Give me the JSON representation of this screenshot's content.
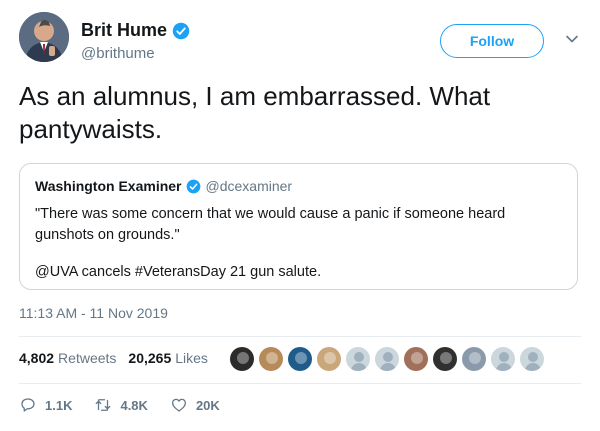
{
  "author": {
    "name": "Brit Hume",
    "handle": "@brithume",
    "follow_label": "Follow"
  },
  "tweet": {
    "text": "As an alumnus, I am embarrassed. What pantywaists."
  },
  "quoted": {
    "name": "Washington Examiner",
    "handle": "@dcexaminer",
    "text": "\"There was some concern that we would cause a panic if someone heard gunshots on grounds.\"",
    "text2": "@UVA cancels  #VeteransDay 21 gun salute."
  },
  "timestamp": "11:13 AM - 11 Nov 2019",
  "stats": {
    "retweets_count": "4,802",
    "retweets_label": "Retweets",
    "likes_count": "20,265",
    "likes_label": "Likes"
  },
  "liker_avatars": [
    "#2b2b2b",
    "#b78a5a",
    "#1f5c8a",
    "#c9a77a",
    "#bfc7cf",
    "#bfc7cf",
    "#a0705a",
    "#303030",
    "#8a9aaa",
    "#bfc7cf",
    "#bfc7cf"
  ],
  "actions": {
    "reply_count": "1.1K",
    "retweet_count": "4.8K",
    "like_count": "20K"
  },
  "colors": {
    "accent": "#1da1f2",
    "secondary_text": "#657786",
    "border": "#ccd6dd"
  }
}
